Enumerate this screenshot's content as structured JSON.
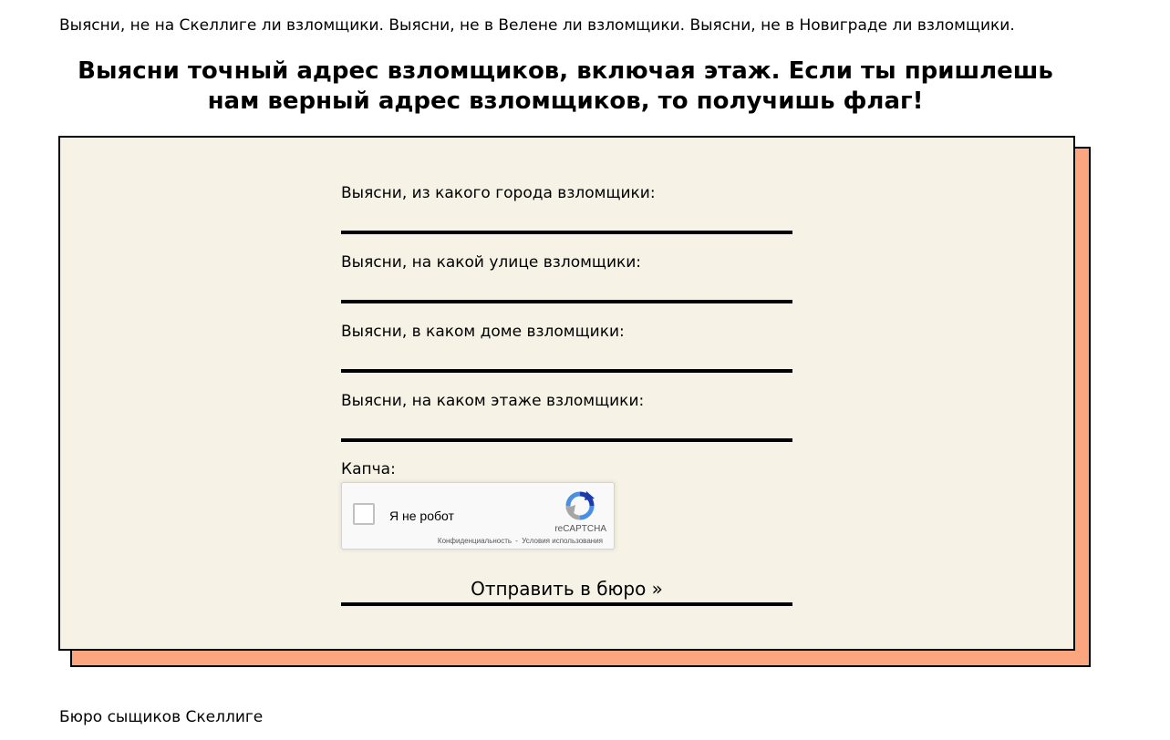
{
  "intro_text": "Выясни, не на Скеллиге ли взломщики. Выясни, не в Велене ли взломщики. Выясни, не в Новиграде ли взломщики.",
  "headline": "Выясни точный адрес взломщиков, включая этаж. Если ты пришлешь нам верный адрес взломщиков, то получишь флаг!",
  "form": {
    "fields": [
      {
        "label": "Выясни, из какого города взломщики:",
        "value": ""
      },
      {
        "label": "Выясни, на какой улице взломщики:",
        "value": ""
      },
      {
        "label": "Выясни, в каком доме взломщики:",
        "value": ""
      },
      {
        "label": "Выясни, на каком этаже взломщики:",
        "value": ""
      }
    ],
    "captcha_label": "Капча:",
    "recaptcha": {
      "checkbox_text": "Я не робот",
      "brand": "reCAPTCHA",
      "privacy_link": "Конфиденциальность",
      "separator": "-",
      "terms_link": "Условия использования"
    },
    "submit_label": "Отправить в бюро »"
  },
  "footer_text": "Бюро сыщиков Скеллиге",
  "colors": {
    "card_background": "#f6f2e5",
    "shadow": "#fca67f",
    "border": "#000000",
    "recaptcha_blue": "#4a90e2",
    "recaptcha_grey": "#a6a6a6"
  }
}
